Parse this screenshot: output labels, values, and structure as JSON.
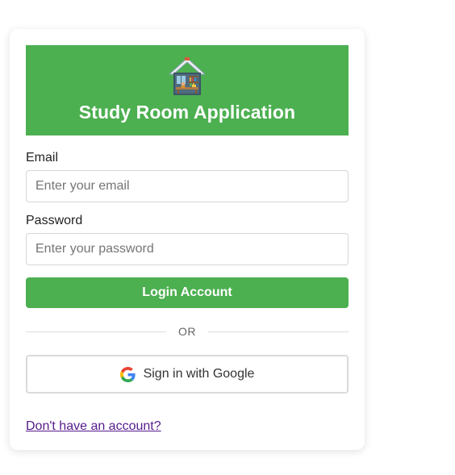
{
  "app": {
    "title": "Study Room Application",
    "logo_icon": "study-room-house-icon"
  },
  "form": {
    "email_label": "Email",
    "email_placeholder": "Enter your email",
    "email_value": "",
    "password_label": "Password",
    "password_placeholder": "Enter your password",
    "password_value": "",
    "login_button": "Login Account",
    "divider_text": "OR",
    "google_button": "Sign in with Google",
    "signup_link": "Don't have an account?"
  },
  "colors": {
    "accent": "#4caf50",
    "link": "#551a8b"
  }
}
